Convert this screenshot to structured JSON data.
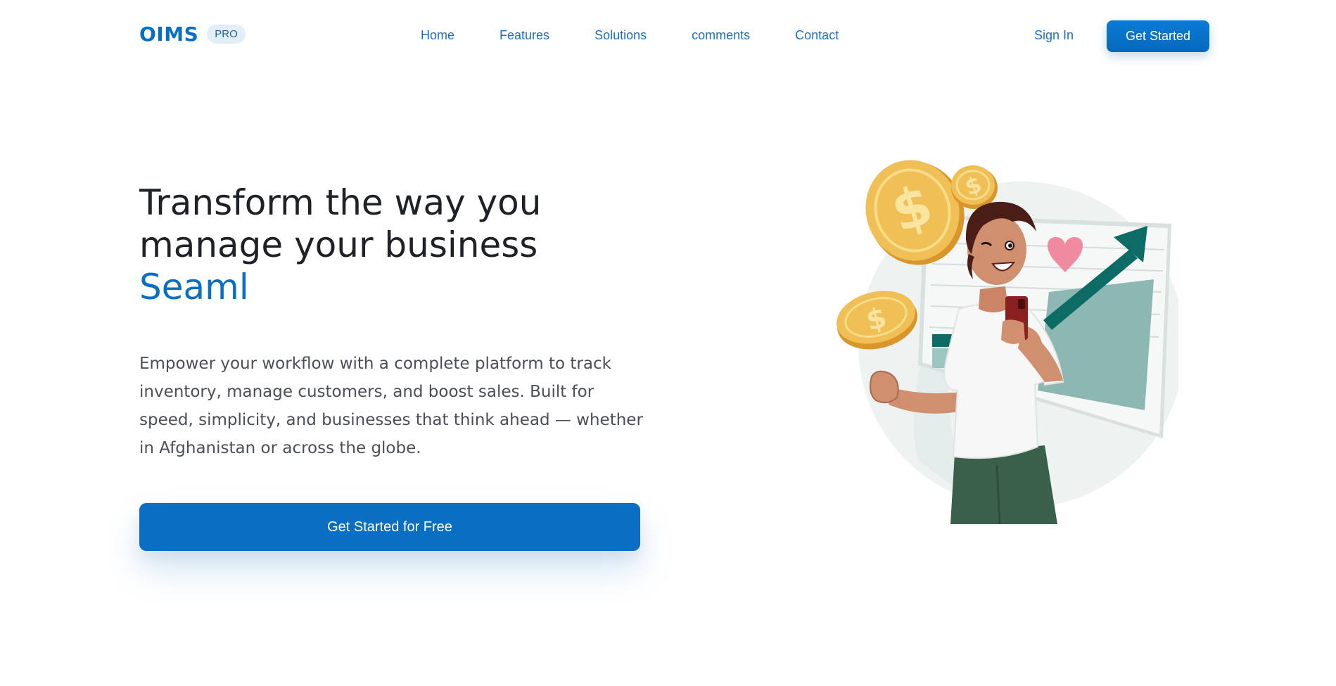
{
  "nav": {
    "brand": "OIMS",
    "badge": "PRO",
    "links": [
      "Home",
      "Features",
      "Solutions",
      "comments",
      "Contact"
    ],
    "sign_in": "Sign In",
    "get_started": "Get Started"
  },
  "hero": {
    "title": "Transform the way you manage your business",
    "accent": "Seaml",
    "description": "Empower your workflow with a complete platform to track inventory, manage customers, and boost sales. Built for speed, simplicity, and businesses that think ahead — whether in Afghanistan or across the globe.",
    "cta": "Get Started for Free"
  },
  "illustration": {
    "icons": [
      "dollar-coin-icon",
      "heart-icon",
      "trend-arrow-icon",
      "smartphone-icon"
    ]
  },
  "colors": {
    "brand": "#0a6fc2",
    "coin": "#e9b44a",
    "chart": "#0d6b66",
    "heart": "#f08aa0"
  }
}
